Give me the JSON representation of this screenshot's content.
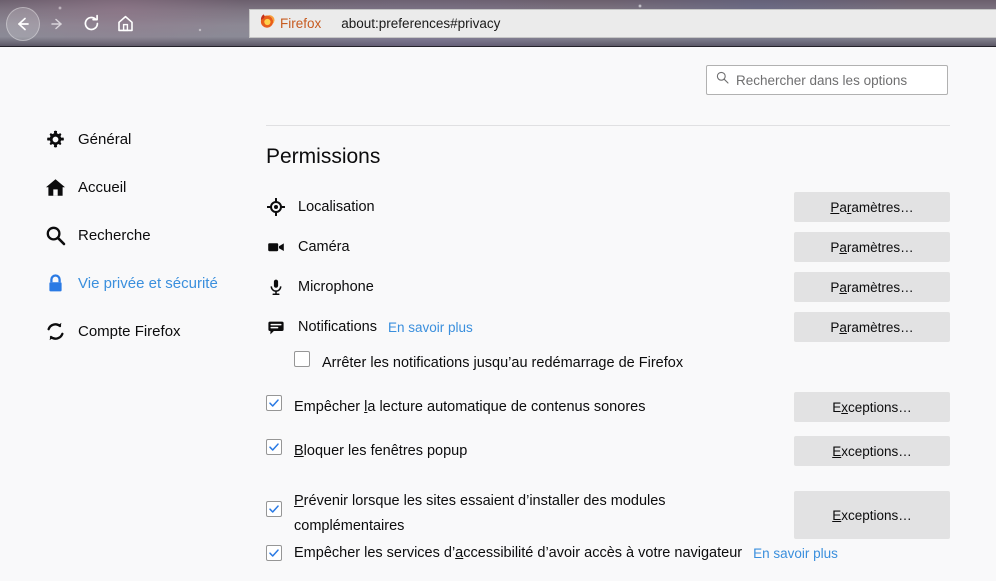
{
  "browser": {
    "nav": {
      "back": "back-arrow",
      "forward": "forward-arrow",
      "reload": "reload-arrow",
      "home": "home-icon"
    },
    "urlbar": {
      "brand": "Firefox",
      "url": "about:preferences#privacy"
    }
  },
  "search": {
    "placeholder": "Rechercher dans les options",
    "value": ""
  },
  "sidebar": {
    "items": [
      {
        "label": "Général",
        "icon": "gear-icon",
        "active": false
      },
      {
        "label": "Accueil",
        "icon": "home-icon",
        "active": false
      },
      {
        "label": "Recherche",
        "icon": "search-icon",
        "active": false
      },
      {
        "label": "Vie privée et sécurité",
        "icon": "lock-icon",
        "active": true
      },
      {
        "label": "Compte Firefox",
        "icon": "sync-icon",
        "active": false
      }
    ]
  },
  "main": {
    "section_title": "Permissions",
    "permissions": [
      {
        "label": "Localisation",
        "icon": "location-icon",
        "button": "Paramètres…",
        "accesskey": "a",
        "link": null
      },
      {
        "label": "Caméra",
        "icon": "camera-icon",
        "button": "Paramètres…",
        "accesskey": "a",
        "link": null
      },
      {
        "label": "Microphone",
        "icon": "microphone-icon",
        "button": "Paramètres…",
        "accesskey": "a",
        "link": null
      },
      {
        "label": "Notifications",
        "icon": "notification-icon",
        "button": "Paramètres…",
        "accesskey": "a",
        "link": "En savoir plus"
      }
    ],
    "checkboxes": [
      {
        "label": "Arrêter les notifications jusqu’au redémarrage de Firefox",
        "checked": false,
        "indented": true,
        "button": null,
        "link": null
      },
      {
        "label_pre": "Empêcher ",
        "label_key": "l",
        "label_post": "a lecture automatique de contenus sonores",
        "checked": true,
        "indented": false,
        "button": "Exceptions…",
        "button_accesskey": "x",
        "link": null
      },
      {
        "label_pre": "",
        "label_key": "B",
        "label_post": "loquer les fenêtres popup",
        "checked": true,
        "indented": false,
        "button": "Exceptions…",
        "button_accesskey": "E",
        "link": null
      },
      {
        "label_pre": "",
        "label_key": "P",
        "label_post": "révenir lorsque les sites essaient d’installer des modules complémentaires",
        "checked": true,
        "indented": false,
        "button": "Exceptions…",
        "button_accesskey": "E",
        "link": null
      },
      {
        "label_pre": "Empêcher les services d’",
        "label_key": "a",
        "label_post": "ccessibilité d’avoir accès à votre navigateur",
        "checked": true,
        "indented": false,
        "button": null,
        "link": "En savoir plus"
      }
    ]
  },
  "colors": {
    "accent": "#3a8fdd",
    "page_bg": "#f9f9fa",
    "button_bg": "#e2e2e3",
    "text": "#0c0c0d",
    "brand_orange": "#c75b20"
  }
}
